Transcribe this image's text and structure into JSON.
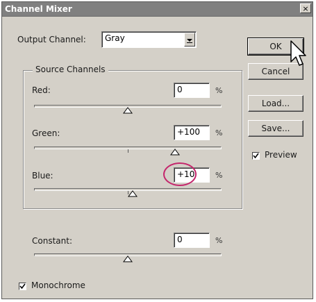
{
  "dialog": {
    "title": "Channel Mixer",
    "close_glyph": "×"
  },
  "output_channel": {
    "label": "Output Channel:",
    "value": "Gray"
  },
  "source_channels": {
    "legend": "Source Channels",
    "red": {
      "label": "Red:",
      "value": "0",
      "unit": "%",
      "slider_fraction": 0.5
    },
    "green": {
      "label": "Green:",
      "value": "+100",
      "unit": "%",
      "slider_fraction": 0.75
    },
    "blue": {
      "label": "Blue:",
      "value": "+10",
      "unit": "%",
      "slider_fraction": 0.525
    }
  },
  "constant": {
    "label": "Constant:",
    "value": "0",
    "unit": "%",
    "slider_fraction": 0.5
  },
  "monochrome": {
    "label": "Monochrome",
    "checked": true
  },
  "buttons": {
    "ok": "OK",
    "cancel": "Cancel",
    "load": "Load...",
    "save": "Save..."
  },
  "preview": {
    "label": "Preview",
    "checked": true
  },
  "colors": {
    "highlight_circle": "#c4266c",
    "dialog_bg": "#d4d0c8",
    "titlebar_bg": "#808080"
  },
  "icons": {
    "pointer": "arrow-cursor-icon",
    "check": "checkmark-icon"
  }
}
